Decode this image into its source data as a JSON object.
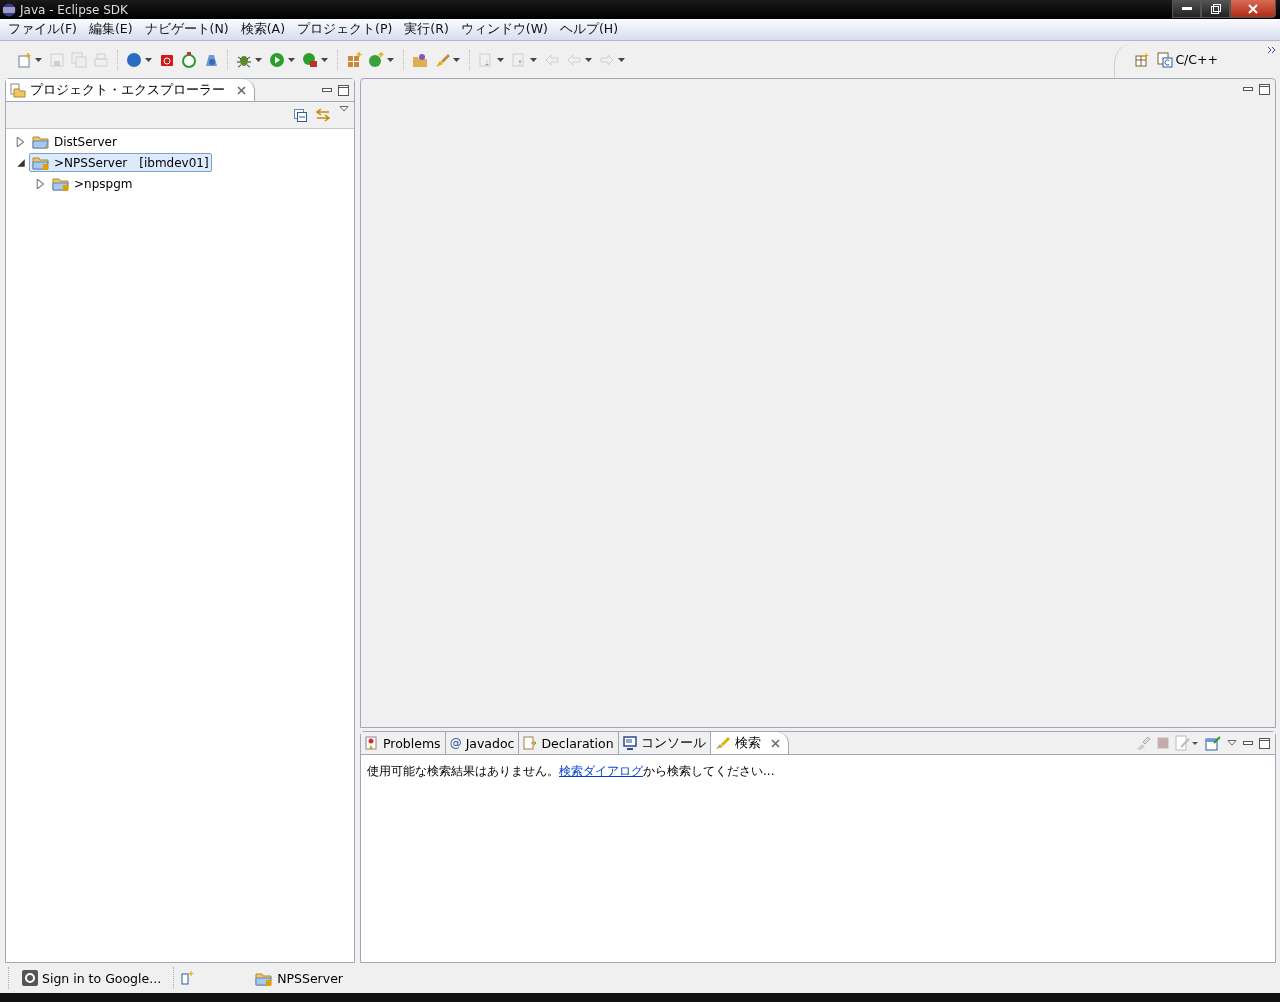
{
  "window": {
    "title": "Java - Eclipse SDK"
  },
  "menu": [
    "ファイル(F)",
    "編集(E)",
    "ナビゲート(N)",
    "検索(A)",
    "プロジェクト(P)",
    "実行(R)",
    "ウィンドウ(W)",
    "ヘルプ(H)"
  ],
  "toolbar": [
    [
      {
        "kind": "new",
        "disabled": false,
        "dropdown": true
      },
      {
        "kind": "save",
        "disabled": true,
        "dropdown": false
      },
      {
        "kind": "save-all",
        "disabled": true,
        "dropdown": false
      },
      {
        "kind": "print",
        "disabled": true,
        "dropdown": false
      }
    ],
    [
      {
        "kind": "globe",
        "disabled": false,
        "dropdown": true
      },
      {
        "kind": "gift",
        "disabled": false,
        "dropdown": false
      },
      {
        "kind": "stopwatch",
        "disabled": false,
        "dropdown": false
      },
      {
        "kind": "gear",
        "disabled": false,
        "dropdown": false
      }
    ],
    [
      {
        "kind": "bug",
        "disabled": false,
        "dropdown": true
      },
      {
        "kind": "run",
        "disabled": false,
        "dropdown": true
      },
      {
        "kind": "run-ext",
        "disabled": false,
        "dropdown": true
      }
    ],
    [
      {
        "kind": "package",
        "disabled": false,
        "dropdown": false
      },
      {
        "kind": "class",
        "disabled": false,
        "dropdown": true
      }
    ],
    [
      {
        "kind": "folder",
        "disabled": false,
        "dropdown": false
      },
      {
        "kind": "brush",
        "disabled": false,
        "dropdown": true
      }
    ],
    [
      {
        "kind": "down",
        "disabled": true,
        "dropdown": true
      },
      {
        "kind": "up",
        "disabled": true,
        "dropdown": true
      },
      {
        "kind": "back-last",
        "disabled": true,
        "dropdown": false
      },
      {
        "kind": "back",
        "disabled": true,
        "dropdown": true
      },
      {
        "kind": "forward",
        "disabled": true,
        "dropdown": true
      }
    ]
  ],
  "perspective": {
    "label": "C/C++"
  },
  "explorer": {
    "title": "プロジェクト・エクスプローラー",
    "tree": [
      {
        "label": "DistServer",
        "expanded": false,
        "selected": false
      },
      {
        "label": ">NPSServer",
        "tag": "[ibmdev01]",
        "expanded": true,
        "selected": true,
        "children": [
          {
            "label": ">npspgm",
            "expanded": false,
            "selected": false
          }
        ]
      }
    ]
  },
  "bottom_tabs": [
    {
      "label": "Problems",
      "kind": "problems",
      "selected": false
    },
    {
      "label": "Javadoc",
      "kind": "at",
      "icon": "@",
      "selected": false
    },
    {
      "label": "Declaration",
      "kind": "declaration",
      "selected": false
    },
    {
      "label": "コンソール",
      "kind": "console",
      "selected": false
    },
    {
      "label": "検索",
      "kind": "search",
      "selected": true
    }
  ],
  "search_view": {
    "message": "使用可能な検索結果はありません。",
    "link": "検索ダイアログ",
    "message_end": "から検索してください..."
  },
  "status_bar": {
    "google": "Sign in to Google...",
    "project": "NPSServer"
  }
}
